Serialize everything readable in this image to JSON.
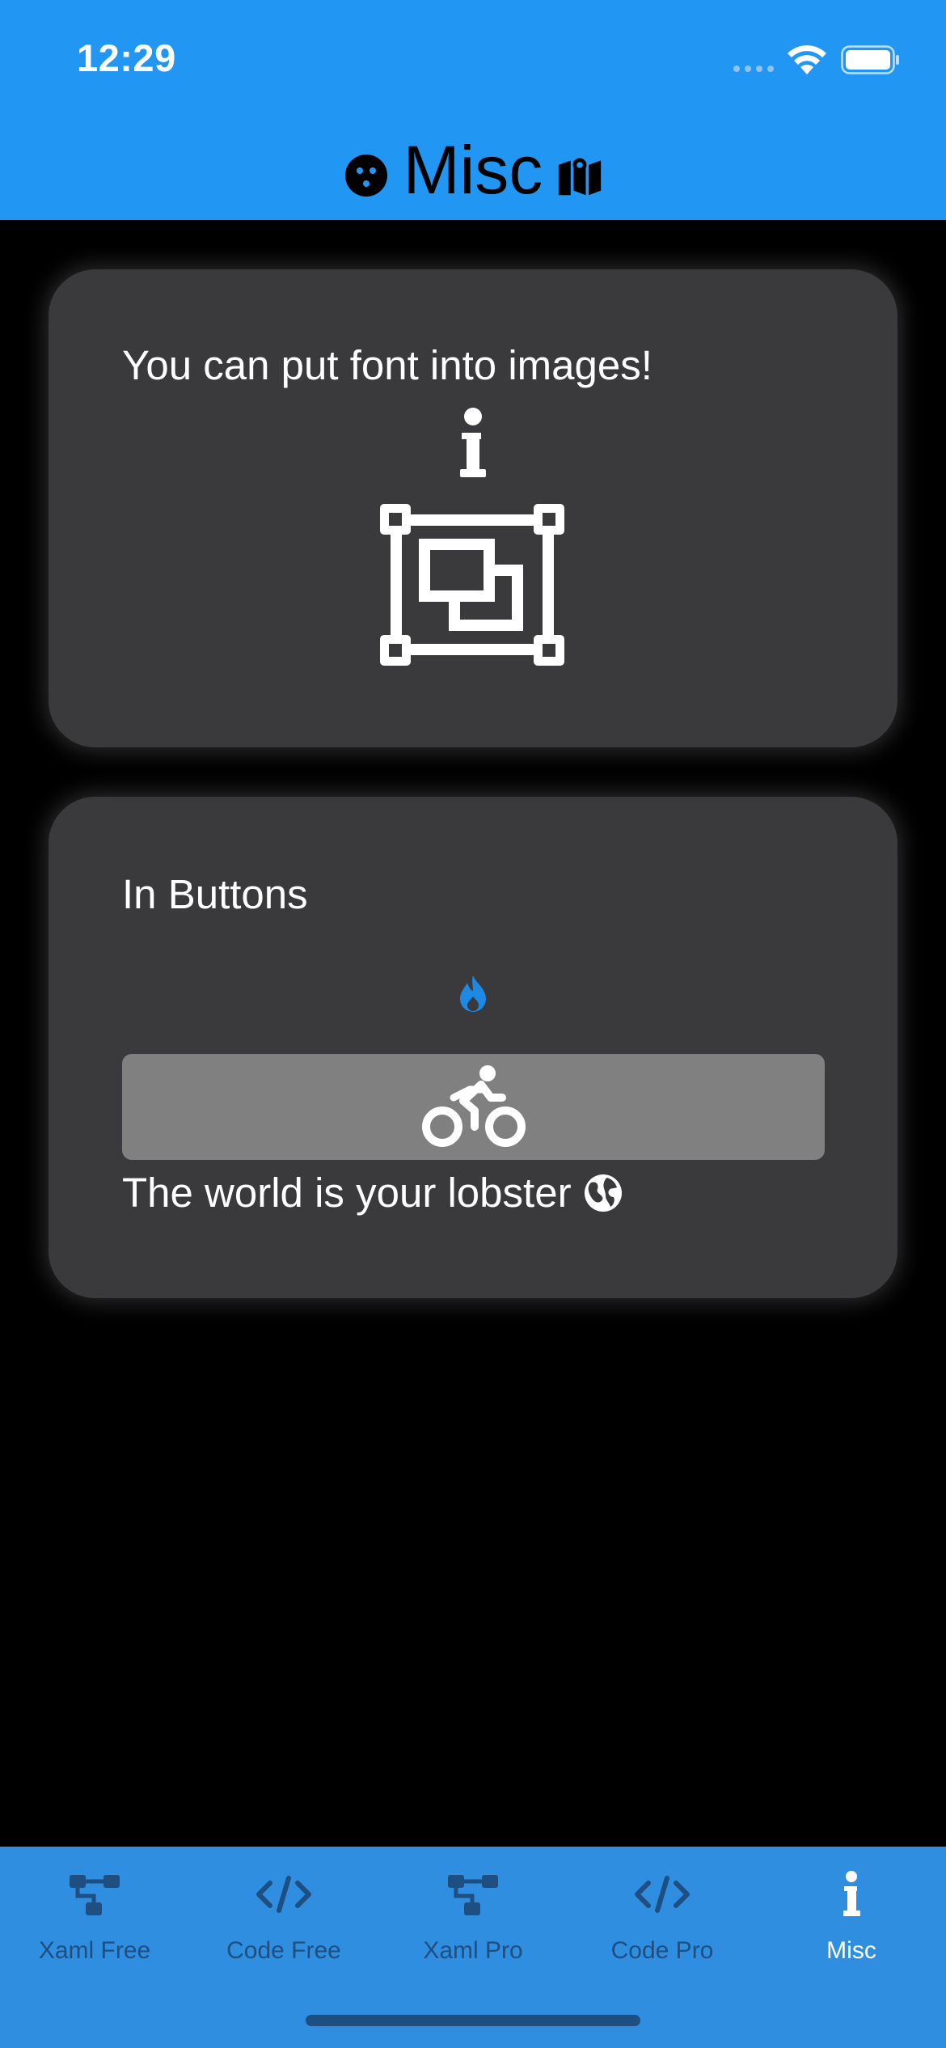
{
  "status_bar": {
    "time": "12:29"
  },
  "nav": {
    "title": "Misc",
    "left_icon": "face-icon",
    "right_icon": "map-icon"
  },
  "cards": {
    "images_card": {
      "text": "You can put font into images!",
      "icons": [
        "info-icon",
        "select-group-icon"
      ]
    },
    "buttons_card": {
      "title": "In Buttons",
      "flame_button_icon": "fire-icon",
      "bike_button_icon": "bicycle-icon",
      "label": "The world is your lobster",
      "label_icon": "globe-icon"
    }
  },
  "tabs": [
    {
      "label": "Xaml Free",
      "icon": "sitemap-icon",
      "active": false
    },
    {
      "label": "Code Free",
      "icon": "code-icon",
      "active": false
    },
    {
      "label": "Xaml Pro",
      "icon": "sitemap-icon",
      "active": false
    },
    {
      "label": "Code Pro",
      "icon": "code-icon",
      "active": false
    },
    {
      "label": "Misc",
      "icon": "info-icon",
      "active": true
    }
  ],
  "colors": {
    "header_blue": "#2196F3",
    "tabbar_blue": "#2F8EE0",
    "card_bg": "#3A3A3C",
    "button_gray": "#808080",
    "accent_blue": "#1E88E5",
    "tab_inactive": "#1F4E80"
  }
}
